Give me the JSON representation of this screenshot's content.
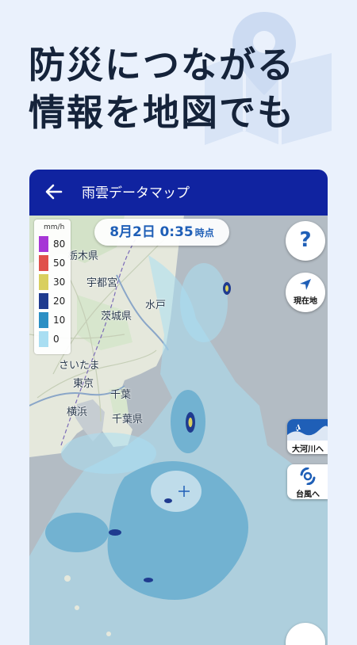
{
  "headline": {
    "line1": "防災につながる",
    "line2": "情報を地図でも"
  },
  "appbar": {
    "title": "雨雲データマップ"
  },
  "time": {
    "date": "8月2日",
    "time": "0:35",
    "unit": "時点"
  },
  "legend": {
    "unit": "mm/h",
    "items": [
      {
        "value": "80",
        "color": "#a636d6"
      },
      {
        "value": "50",
        "color": "#e0504a"
      },
      {
        "value": "30",
        "color": "#d9cf5e"
      },
      {
        "value": "20",
        "color": "#1f3b8f"
      },
      {
        "value": "10",
        "color": "#2b8fc4"
      },
      {
        "value": "0",
        "color": "#a9def2"
      }
    ]
  },
  "buttons": {
    "help": "?",
    "current_location": "現在地",
    "rivers": "大河川へ",
    "typhoon": "台風へ"
  },
  "map_labels": {
    "tochigi": "栃木県",
    "utsunomiya": "宇都宮",
    "mito": "水戸",
    "ibaraki": "茨城県",
    "saitama": "さいたま",
    "tokyo": "東京",
    "chiba_city": "千葉",
    "yokohama": "横浜",
    "chiba_pref": "千葉県"
  }
}
